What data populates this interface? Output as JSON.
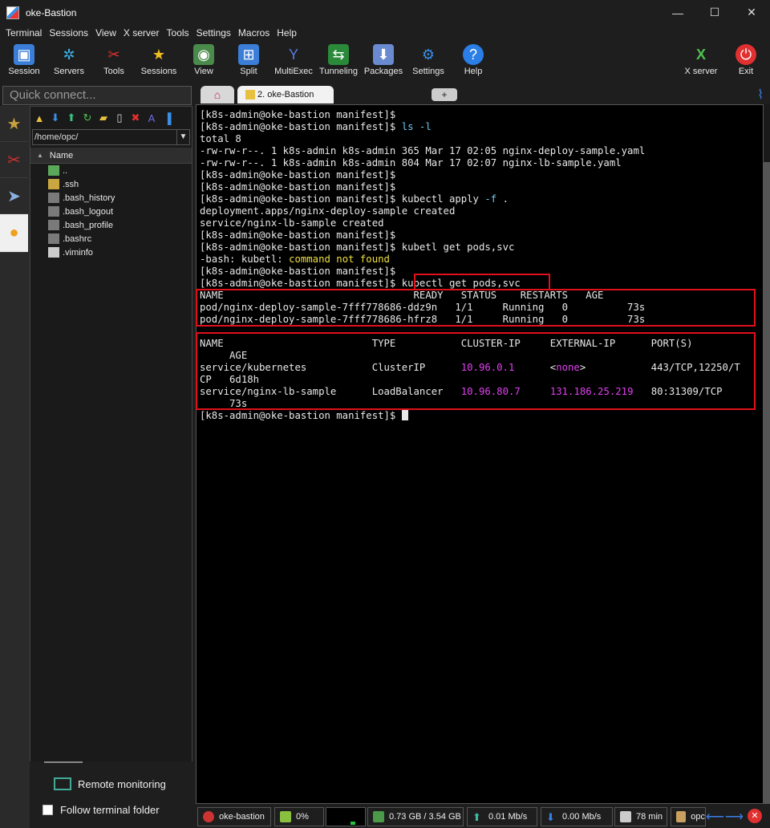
{
  "window": {
    "title": "oke-Bastion",
    "minimize": "—",
    "maximize": "☐",
    "close": "✕"
  },
  "menu": [
    "Terminal",
    "Sessions",
    "View",
    "X server",
    "Tools",
    "Settings",
    "Macros",
    "Help"
  ],
  "toolbar": {
    "session": "Session",
    "servers": "Servers",
    "tools": "Tools",
    "sessions": "Sessions",
    "view": "View",
    "split": "Split",
    "multiexec": "MultiExec",
    "tunneling": "Tunneling",
    "packages": "Packages",
    "settings": "Settings",
    "help": "Help",
    "xserver": "X server",
    "exit": "Exit"
  },
  "quick_connect": {
    "placeholder": "Quick connect..."
  },
  "file_browser": {
    "path": "/home/opc/",
    "column": "Name",
    "files": [
      "..",
      ".ssh",
      ".bash_history",
      ".bash_logout",
      ".bash_profile",
      ".bashrc",
      ".viminfo"
    ]
  },
  "remote_monitoring": "Remote monitoring",
  "follow_folder": "Follow terminal folder",
  "tabs": {
    "session_tab": "2. oke-Bastion"
  },
  "terminal": {
    "prompt": "[k8s-admin@oke-bastion manifest]$",
    "lines": {
      "l1": "[k8s-admin@oke-bastion manifest]$",
      "l2_prompt": "[k8s-admin@oke-bastion manifest]$ ",
      "l2_cmd": "ls",
      "l2_flag": " -l",
      "l3": "total 8",
      "l4": "-rw-rw-r--. 1 k8s-admin k8s-admin 365 Mar 17 02:05 nginx-deploy-sample.yaml",
      "l5": "-rw-rw-r--. 1 k8s-admin k8s-admin 804 Mar 17 02:07 nginx-lb-sample.yaml",
      "l6": "[k8s-admin@oke-bastion manifest]$",
      "l7": "[k8s-admin@oke-bastion manifest]$",
      "l8_prompt": "[k8s-admin@oke-bastion manifest]$ ",
      "l8_cmd": "kubectl apply",
      "l8_flag": " -f",
      "l8_rest": " .",
      "l9": "deployment.apps/nginx-deploy-sample created",
      "l10": "service/nginx-lb-sample created",
      "l11": "[k8s-admin@oke-bastion manifest]$",
      "l12": "[k8s-admin@oke-bastion manifest]$ kubetl get pods,svc",
      "l13_a": "-bash: kubetl: ",
      "l13_b": "command not found",
      "l14": "[k8s-admin@oke-bastion manifest]$",
      "l15_prompt": "[k8s-admin@oke-bastion manifest]$",
      "l15_cmd": "kubectl get pods,svc",
      "l16": "NAME                                READY   STATUS    RESTARTS   AGE",
      "l17": "pod/nginx-deploy-sample-7fff778686-ddz9n   1/1     Running   0          73s",
      "l18": "pod/nginx-deploy-sample-7fff778686-hfrz8   1/1     Running   0          73s",
      "l19": "",
      "l20": "NAME                         TYPE           CLUSTER-IP     EXTERNAL-IP      PORT(S)",
      "l21": "     AGE",
      "l22_a": "service/kubernetes           ClusterIP      ",
      "l22_ip": "10.96.0.1",
      "l22_b": "      <",
      "l22_none": "none",
      "l22_c": ">           443/TCP,12250/T",
      "l23": "CP   6d18h",
      "l24_a": "service/nginx-lb-sample      LoadBalancer   ",
      "l24_ip": "10.96.80.7",
      "l24_b": "     ",
      "l24_ext": "131.186.25.219",
      "l24_c": "   80:31309/TCP",
      "l25": "     73s",
      "l26": "[k8s-admin@oke-bastion manifest]$ "
    }
  },
  "status": {
    "host": "oke-bastion",
    "cpu": "0%",
    "mem": "0.73 GB / 3.54 GB",
    "up": "0.01 Mb/s",
    "down": "0.00 Mb/s",
    "uptime": "78 min",
    "user": "opc"
  },
  "colors": {
    "red_box": "#e0101a",
    "magenta": "#e040f0",
    "cyan": "#6ec8f0",
    "yellow": "#f0e040"
  }
}
